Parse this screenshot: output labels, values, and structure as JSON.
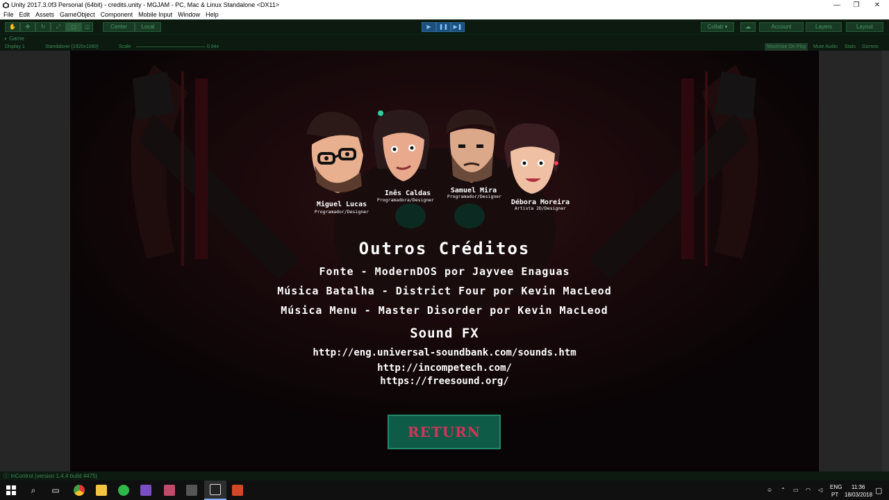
{
  "window": {
    "title": "Unity 2017.3.0f3 Personal (64bit) - credits.unity - MGJAM - PC, Mac & Linux Standalone <DX11>",
    "minimize": "—",
    "maximize": "❐",
    "close": "✕"
  },
  "menu": [
    "File",
    "Edit",
    "Assets",
    "GameObject",
    "Component",
    "Mobile Input",
    "Window",
    "Help"
  ],
  "toolbar": {
    "pivot": "Center",
    "space": "Local",
    "play": "▶",
    "pause": "❚❚",
    "step": "▶❚",
    "collab": "Collab ▾",
    "account": "Account",
    "layers": "Layers",
    "layout": "Layout"
  },
  "game_view": {
    "tab": "Game",
    "display": "Display 1",
    "resolution": "Standalone (1920x1080)",
    "scale_label": "Scale",
    "scale_value": "0.84x",
    "maximize_on_play": "Maximize On Play",
    "mute_audio": "Mute Audio",
    "stats": "Stats",
    "gizmos": "Gizmos"
  },
  "credits": {
    "team": [
      {
        "name": "Miguel Lucas",
        "role": "Programador/Designer"
      },
      {
        "name": "Inês Caldas",
        "role": "Programadora/Designer"
      },
      {
        "name": "Samuel Mira",
        "role": "Programador/Designer"
      },
      {
        "name": "Débora Moreira",
        "role": "Artista 2D/Designer"
      }
    ],
    "heading": "Outros Créditos",
    "lines": [
      "Fonte - ModernDOS por Jayvee Enaguas",
      "Música Batalha - District Four por Kevin MacLeod",
      "Música Menu - Master Disorder por Kevin MacLeod"
    ],
    "sfx_heading": "Sound FX",
    "links": [
      "http://eng.universal-soundbank.com/sounds.htm",
      "http://incompetech.com/",
      "https://freesound.org/"
    ],
    "return_button": "RETURN"
  },
  "status": "InControl (version 1.4.4 build 4475)",
  "taskbar": {
    "language": "ENG",
    "keyboard": "PT",
    "time": "11:36",
    "date": "18/03/2018"
  },
  "colors": {
    "editor_bar": "#0c1a10",
    "game_bg": "#0d0608",
    "return_bg": "#0e5c48",
    "return_text": "#d4335a"
  }
}
